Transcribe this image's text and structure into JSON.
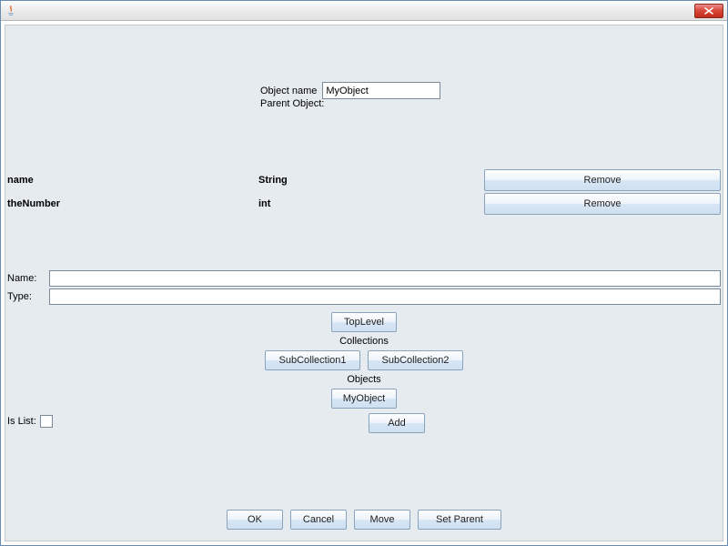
{
  "header": {
    "object_name_label": "Object name",
    "object_name_value": "MyObject",
    "parent_object_label": "Parent Object:"
  },
  "attributes": [
    {
      "name": "name",
      "type": "String",
      "remove_label": "Remove"
    },
    {
      "name": "theNumber",
      "type": "int",
      "remove_label": "Remove"
    }
  ],
  "fields": {
    "name_label": "Name:",
    "name_value": "",
    "type_label": "Type:",
    "type_value": ""
  },
  "center": {
    "toplevel_label": "TopLevel",
    "collections_label": "Collections",
    "subcollections": [
      "SubCollection1",
      "SubCollection2"
    ],
    "objects_label": "Objects",
    "objects": [
      "MyObject"
    ],
    "add_label": "Add"
  },
  "islist_label": "Is List:",
  "islist_checked": false,
  "bottom": {
    "ok": "OK",
    "cancel": "Cancel",
    "move": "Move",
    "set_parent": "Set Parent"
  }
}
